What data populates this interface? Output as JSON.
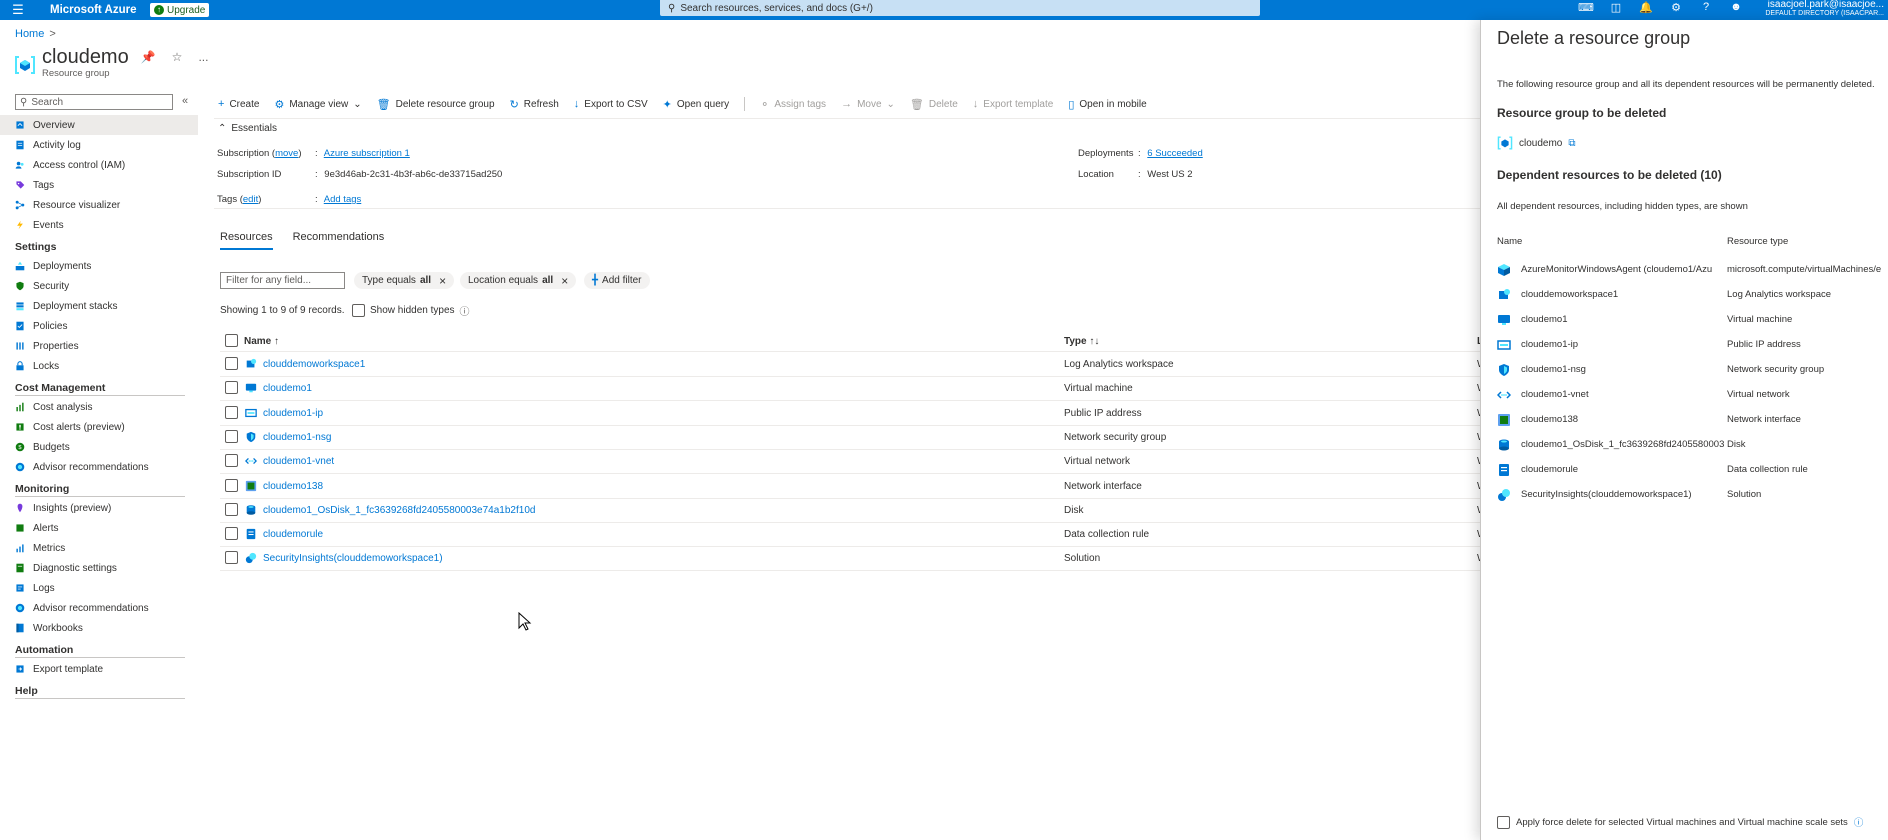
{
  "topbar": {
    "brand": "Microsoft Azure",
    "upgrade_label": "Upgrade",
    "search_placeholder": "Search resources, services, and docs (G+/)",
    "account_user": "isaacjoel.park@isaacjoe...",
    "account_directory": "DEFAULT DIRECTORY (ISAACPAR..."
  },
  "breadcrumb": {
    "home": "Home",
    "sep": ">"
  },
  "header": {
    "title": "cloudemo",
    "subtitle": "Resource group",
    "more": "..."
  },
  "leftnav": {
    "search_placeholder": "Search",
    "items": [
      {
        "label": "Overview",
        "icon": "overview-icon",
        "active": true
      },
      {
        "label": "Activity log",
        "icon": "activity-log-icon"
      },
      {
        "label": "Access control (IAM)",
        "icon": "iam-icon"
      },
      {
        "label": "Tags",
        "icon": "tag-icon"
      },
      {
        "label": "Resource visualizer",
        "icon": "visualizer-icon"
      },
      {
        "label": "Events",
        "icon": "lightning-icon"
      }
    ],
    "settings_header": "Settings",
    "settings_items": [
      {
        "label": "Deployments",
        "icon": "deployments-icon"
      },
      {
        "label": "Security",
        "icon": "shield-icon"
      },
      {
        "label": "Deployment stacks",
        "icon": "stacks-icon"
      },
      {
        "label": "Policies",
        "icon": "policy-icon"
      },
      {
        "label": "Properties",
        "icon": "properties-icon"
      },
      {
        "label": "Locks",
        "icon": "lock-icon"
      }
    ],
    "cost_header": "Cost Management",
    "cost_items": [
      {
        "label": "Cost analysis",
        "icon": "cost-analysis-icon"
      },
      {
        "label": "Cost alerts (preview)",
        "icon": "cost-alerts-icon"
      },
      {
        "label": "Budgets",
        "icon": "budgets-icon"
      },
      {
        "label": "Advisor recommendations",
        "icon": "advisor-icon"
      }
    ],
    "monitoring_header": "Monitoring",
    "monitoring_items": [
      {
        "label": "Insights (preview)",
        "icon": "insights-icon"
      },
      {
        "label": "Alerts",
        "icon": "alerts-icon"
      },
      {
        "label": "Metrics",
        "icon": "metrics-icon"
      },
      {
        "label": "Diagnostic settings",
        "icon": "diagnostic-icon"
      },
      {
        "label": "Logs",
        "icon": "logs-icon"
      },
      {
        "label": "Advisor recommendations",
        "icon": "advisor-icon"
      },
      {
        "label": "Workbooks",
        "icon": "workbooks-icon"
      }
    ],
    "automation_header": "Automation",
    "automation_items": [
      {
        "label": "Export template",
        "icon": "export-template-icon"
      }
    ],
    "help_header": "Help"
  },
  "toolbar": {
    "create": "Create",
    "manage_view": "Manage view",
    "delete_rg": "Delete resource group",
    "refresh": "Refresh",
    "export_csv": "Export to CSV",
    "open_query": "Open query",
    "assign_tags": "Assign tags",
    "move": "Move",
    "delete": "Delete",
    "export_template": "Export template",
    "open_mobile": "Open in mobile"
  },
  "essentials": {
    "label": "Essentials",
    "subscription_key": "Subscription",
    "subscription_move": "move",
    "subscription_value": "Azure subscription 1",
    "subscription_id_key": "Subscription ID",
    "subscription_id_value": "9e3d46ab-2c31-4b3f-ab6c-de33715ad250",
    "tags_key": "Tags",
    "tags_edit": "edit",
    "tags_value": "Add tags",
    "deployments_key": "Deployments",
    "deployments_value": "6 Succeeded",
    "location_key": "Location",
    "location_value": "West US 2"
  },
  "tabs": [
    "Resources",
    "Recommendations"
  ],
  "filters": {
    "placeholder": "Filter for any field...",
    "type_pill_prefix": "Type equals",
    "type_pill_value": "all",
    "location_pill_prefix": "Location equals",
    "location_pill_value": "all",
    "add_filter": "Add filter"
  },
  "records": "Showing 1 to 9 of 9 records.",
  "show_hidden": "Show hidden types",
  "table": {
    "col_name": "Name",
    "col_type": "Type",
    "col_location": "L",
    "rows": [
      {
        "name": "clouddemoworkspace1",
        "type": "Log Analytics workspace",
        "loc": "W",
        "icon": "log-analytics-icon"
      },
      {
        "name": "cloudemo1",
        "type": "Virtual machine",
        "loc": "W",
        "icon": "vm-icon"
      },
      {
        "name": "cloudemo1-ip",
        "type": "Public IP address",
        "loc": "W",
        "icon": "public-ip-icon"
      },
      {
        "name": "cloudemo1-nsg",
        "type": "Network security group",
        "loc": "W",
        "icon": "nsg-icon"
      },
      {
        "name": "cloudemo1-vnet",
        "type": "Virtual network",
        "loc": "W",
        "icon": "vnet-icon"
      },
      {
        "name": "cloudemo138",
        "type": "Network interface",
        "loc": "W",
        "icon": "nic-icon"
      },
      {
        "name": "cloudemo1_OsDisk_1_fc3639268fd2405580003e74a1b2f10d",
        "type": "Disk",
        "loc": "W",
        "icon": "disk-icon"
      },
      {
        "name": "cloudemorule",
        "type": "Data collection rule",
        "loc": "W",
        "icon": "dcr-icon"
      },
      {
        "name": "SecurityInsights(clouddemoworkspace1)",
        "type": "Solution",
        "loc": "W",
        "icon": "solution-icon"
      }
    ]
  },
  "panel": {
    "title": "Delete a resource group",
    "description": "The following resource group and all its dependent resources will be permanently deleted.",
    "rg_section": "Resource group to be deleted",
    "rg_name": "cloudemo",
    "dep_section": "Dependent resources to be deleted (10)",
    "dep_note": "All dependent resources, including hidden types, are shown",
    "col_name": "Name",
    "col_type": "Resource type",
    "rows": [
      {
        "name": "AzureMonitorWindowsAgent (cloudemo1/Azu",
        "type": "microsoft.compute/virtualMachines/e",
        "icon": "extension-icon"
      },
      {
        "name": "clouddemoworkspace1",
        "type": "Log Analytics workspace",
        "icon": "log-analytics-icon"
      },
      {
        "name": "cloudemo1",
        "type": "Virtual machine",
        "icon": "vm-icon"
      },
      {
        "name": "cloudemo1-ip",
        "type": "Public IP address",
        "icon": "public-ip-icon"
      },
      {
        "name": "cloudemo1-nsg",
        "type": "Network security group",
        "icon": "nsg-icon"
      },
      {
        "name": "cloudemo1-vnet",
        "type": "Virtual network",
        "icon": "vnet-icon"
      },
      {
        "name": "cloudemo138",
        "type": "Network interface",
        "icon": "nic-icon"
      },
      {
        "name": "cloudemo1_OsDisk_1_fc3639268fd2405580003",
        "type": "Disk",
        "icon": "disk-icon"
      },
      {
        "name": "cloudemorule",
        "type": "Data collection rule",
        "icon": "dcr-icon"
      },
      {
        "name": "SecurityInsights(clouddemoworkspace1)",
        "type": "Solution",
        "icon": "solution-icon"
      }
    ],
    "force_delete": "Apply force delete for selected Virtual machines and Virtual machine scale sets"
  },
  "colors": {
    "accent": "#0078d4",
    "topbar": "#0078d4",
    "search": "#c7e0f4"
  }
}
